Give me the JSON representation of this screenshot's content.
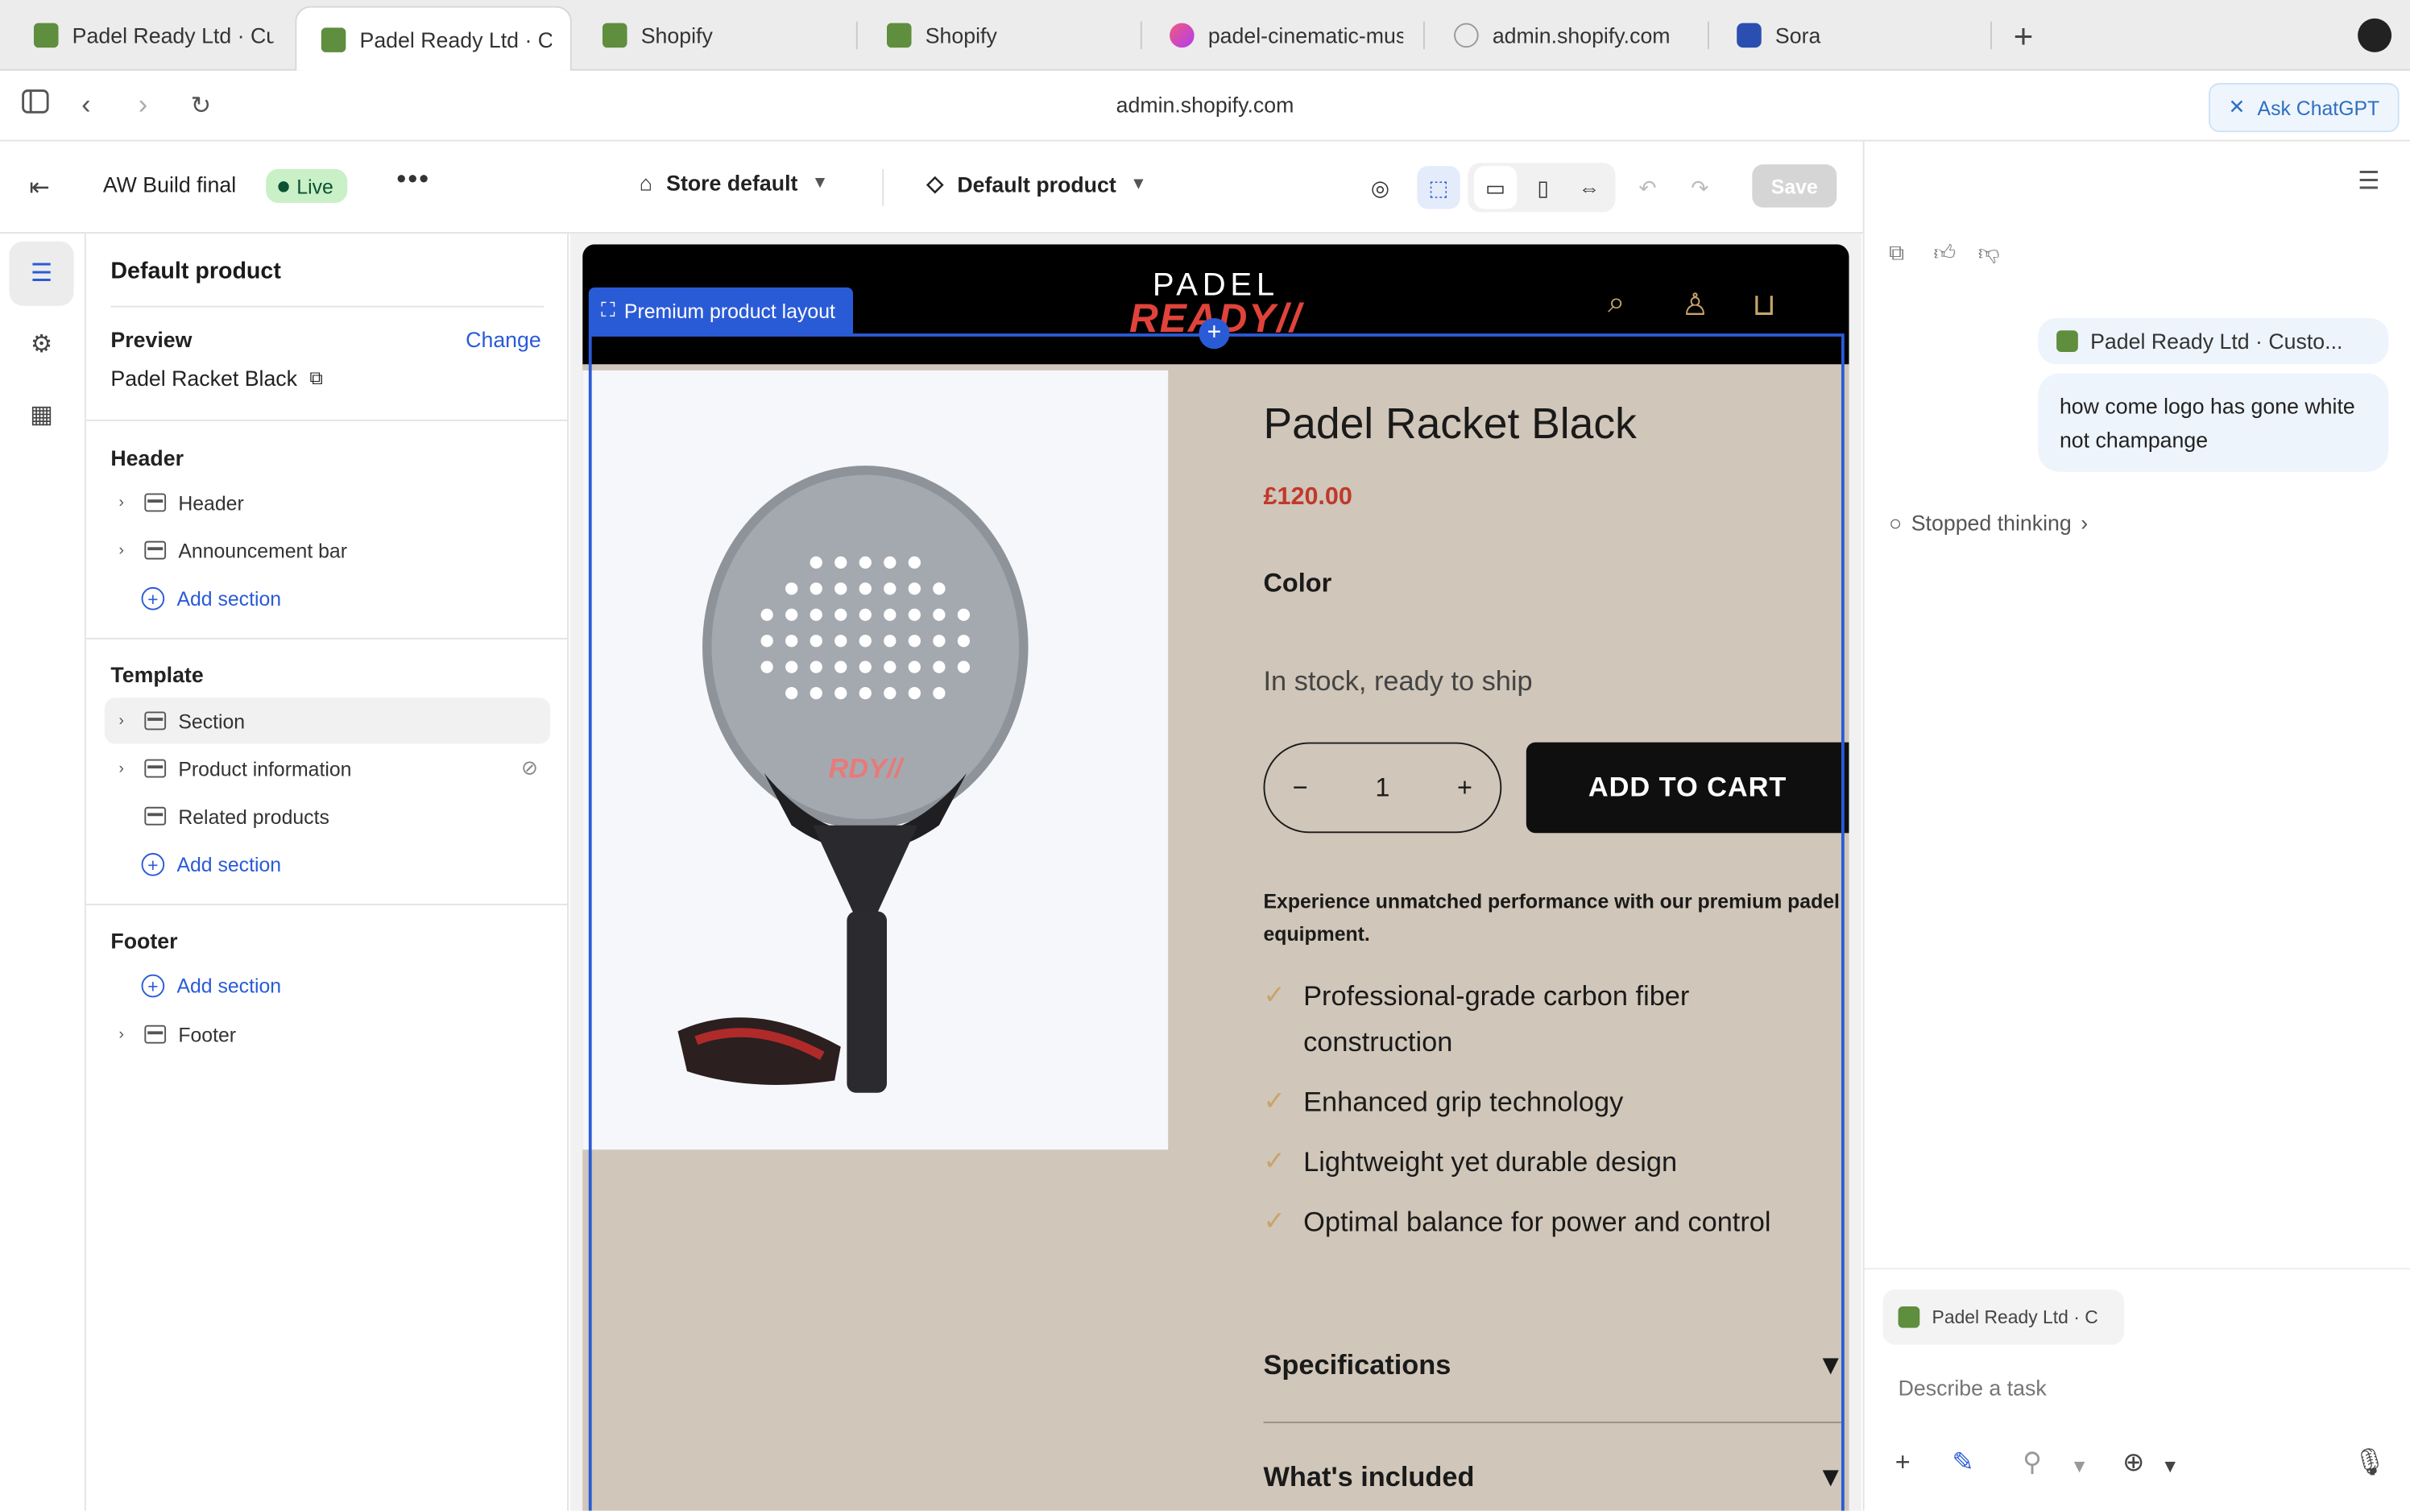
{
  "browser": {
    "tabs": [
      {
        "label": "Padel Ready Ltd · Cu",
        "icon": "shopify-icon"
      },
      {
        "label": "Padel Ready Ltd · Cu",
        "icon": "shopify-icon",
        "active": true
      },
      {
        "label": "Shopify",
        "icon": "shopify-icon"
      },
      {
        "label": "Shopify",
        "icon": "shopify-icon"
      },
      {
        "label": "padel-cinematic-mus",
        "icon": "gradient-app-icon"
      },
      {
        "label": "admin.shopify.com",
        "icon": "compass-icon"
      },
      {
        "label": "Sora",
        "icon": "sora-icon"
      }
    ],
    "url": "admin.shopify.com",
    "ask_chatgpt": "Ask ChatGPT"
  },
  "toolbar": {
    "theme_name": "AW Build final",
    "live_badge": "Live",
    "store_select": "Store default",
    "template_select": "Default product",
    "save_label": "Save"
  },
  "left_panel": {
    "title": "Default product",
    "preview_label": "Preview",
    "change_link": "Change",
    "preview_product": "Padel Racket Black",
    "header_group": {
      "title": "Header",
      "items": [
        "Header",
        "Announcement bar"
      ],
      "add_section": "Add section"
    },
    "template_group": {
      "title": "Template",
      "items": [
        "Section",
        "Product information",
        "Related products"
      ],
      "add_section": "Add section"
    },
    "footer_group": {
      "title": "Footer",
      "add_section": "Add section",
      "items": [
        "Footer"
      ]
    }
  },
  "preview": {
    "logo_top": "PADEL",
    "logo_bottom": "READY//",
    "selected_section_tag": "Premium product layout",
    "product_title": "Padel Racket Black",
    "price": "£120.00",
    "color_label": "Color",
    "stock_status": "In stock, ready to ship",
    "quantity": "1",
    "add_to_cart": "ADD TO CART",
    "description": "Experience unmatched performance with our premium padel equipment.",
    "features": [
      "Professional-grade carbon fiber construction",
      "Enhanced grip technology",
      "Lightweight yet durable design",
      "Optimal balance for power and control"
    ],
    "accordions": [
      "Specifications",
      "What's included"
    ],
    "racket_brand_mark": "RDY//"
  },
  "chat": {
    "context_chip": "Padel Ready Ltd · Custo...",
    "user_message": "how come logo has gone white not champange",
    "thinking_status": "Stopped thinking",
    "attachment_chip": "Padel Ready Ltd · C",
    "input_placeholder": "Describe a task"
  }
}
